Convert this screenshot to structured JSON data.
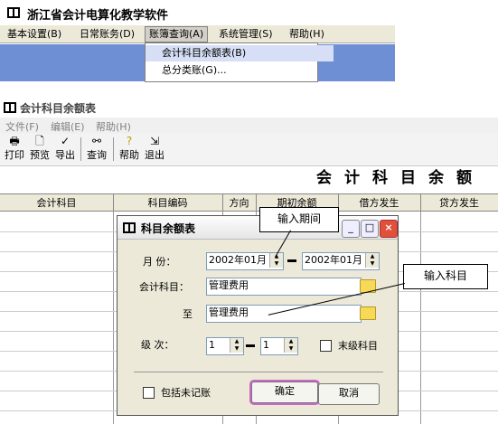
{
  "top_window": {
    "title": "浙江省会计电算化教学软件",
    "menus": [
      "基本设置(B)",
      "日常账务(D)",
      "账簿查询(A)",
      "系统管理(S)",
      "帮助(H)"
    ],
    "dropdown_items": [
      "会计科目余额表(B)",
      "总分类账(G)..."
    ]
  },
  "report_window": {
    "title": "会计科目余额表",
    "menus": [
      "文件(F)",
      "编辑(E)",
      "帮助(H)"
    ],
    "toolbar": [
      {
        "label": "打印",
        "icon": "printer-icon"
      },
      {
        "label": "预览",
        "icon": "preview-icon"
      },
      {
        "label": "导出",
        "icon": "export-icon"
      },
      {
        "label": "查询",
        "icon": "binoculars-icon"
      },
      {
        "label": "帮助",
        "icon": "help-icon"
      },
      {
        "label": "退出",
        "icon": "exit-icon"
      }
    ],
    "report_heading": "会计科目余额",
    "columns": [
      "会计科目",
      "科目编码",
      "方向",
      "期初余额",
      "借方发生",
      "贷方发生"
    ]
  },
  "dialog": {
    "title": "科目余额表",
    "month_label": "月   份：",
    "month_from": "2002年01月",
    "month_to": "2002年01月",
    "account_label": "会计科目：",
    "account_from": "管理费用",
    "to_label": "至",
    "account_to": "管理费用",
    "level_label": "级   次：",
    "level_from": "1",
    "level_to": "1",
    "leaf_only_label": "末级科目",
    "include_unposted_label": "包括未记账",
    "ok_label": "确定",
    "cancel_label": "取消"
  },
  "callouts": {
    "period": "输入期间",
    "account": "输入科目"
  },
  "colors": {
    "blue_band": "#6f8fd4",
    "dialog_bg": "#ece9d8",
    "close_red": "#e0503a",
    "ok_highlight": "#cc66cc"
  }
}
